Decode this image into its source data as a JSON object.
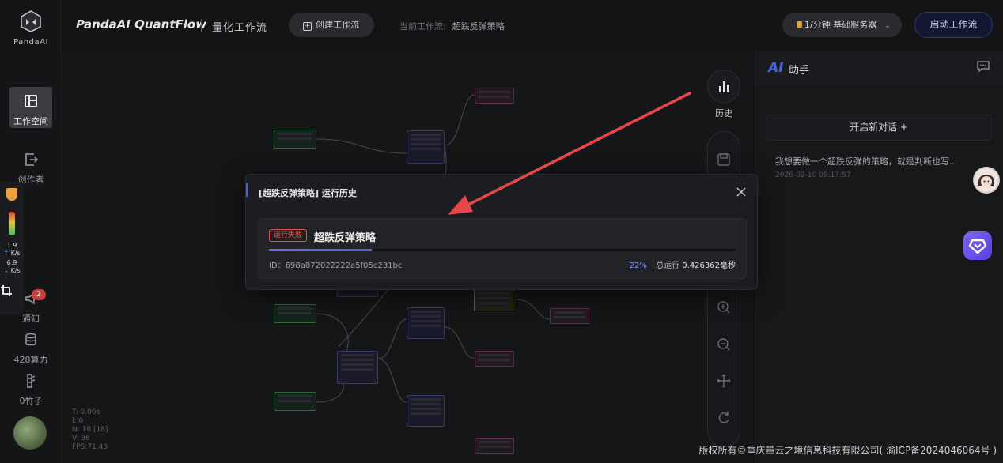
{
  "nav": {
    "logo_text": "PandaAI",
    "workspace": "工作空间",
    "creator": "创作者",
    "notify": "通知",
    "notify_count": "2",
    "power": "428算力",
    "bamboo": "0竹子"
  },
  "netmon": {
    "up_value": "1.9",
    "up_unit": "K/s",
    "down_value": "6.9",
    "down_unit": "K/s"
  },
  "stats": {
    "t": "T: 0.00s",
    "i": "I: 0",
    "n": "N: 18 [18]",
    "v": "V: 36",
    "fps": "FPS:71.43"
  },
  "topbar": {
    "brand": "PandaAI QuantFlow",
    "subtitle": "量化工作流",
    "create_label": "创建工作流",
    "current_label": "当前工作流:",
    "current_value": "超跌反弹策略",
    "server_label": "1/分钟  基础服务器",
    "start_label": "启动工作流"
  },
  "tools": {
    "history_label": "历史"
  },
  "ai": {
    "logo": "AI",
    "title": "助手",
    "new_chat": "开启新对话 +",
    "history_title": "我想要做一个超跌反弹的策略，就是判断也写...",
    "history_time": "2026-02-10 09:17:57"
  },
  "modal": {
    "title": "[超跌反弹策略] 运行历史",
    "status": "运行失败",
    "run_name": "超跌反弹策略",
    "run_id": "ID：698a872022222a5f05c231bc",
    "progress_pct": 22,
    "progress_text": "22%",
    "total_label": "总运行",
    "total_value": "0.426362毫秒"
  },
  "footer": "版权所有©重庆量云之境信息科技有限公司( 渝ICP备2024046064号 )",
  "colors": {
    "accent": "#4b63d9",
    "error": "#d9534f",
    "arrow": "#e8474a"
  }
}
